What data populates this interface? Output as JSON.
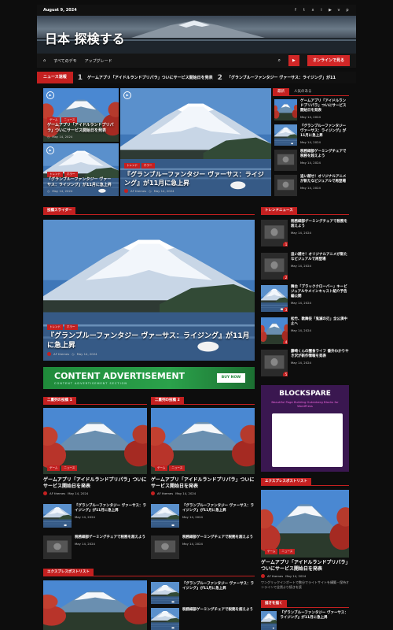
{
  "topbar": {
    "date": "August 9, 2024",
    "socials": [
      "f",
      "t",
      "x",
      "i",
      "▶",
      "v",
      "p"
    ]
  },
  "header": {
    "site_title": "日本 探検する"
  },
  "nav": {
    "items": [
      "すべてのデモ",
      "アップグレード"
    ],
    "live_label": "オンラインで見る"
  },
  "ticker": {
    "label": "ニュース速報",
    "items": [
      {
        "num": "1",
        "text": "ゲームアプリ「アイドルランドプリパラ」ついにサービス開始日を発表"
      },
      {
        "num": "2",
        "text": "「グランブルーファンタジー ヴァーサス：ライジング」が11"
      }
    ]
  },
  "hero": {
    "left_cards": [
      {
        "tags": [
          "ゲーム",
          "ニュース"
        ],
        "title": "ゲームアプリ「アイドルランドプリパラ」ついにサービス開始日を発表",
        "date": "May 14, 2024"
      },
      {
        "tags": [
          "トレンド",
          "ホラー"
        ],
        "title": "『グランブルーファンタジー ヴァーサス：ライジング』が11月に急上昇",
        "date": "May 14, 2024"
      }
    ],
    "main": {
      "tags": [
        "トレンド",
        "ホラー"
      ],
      "title": "『グランブルーファンタジー ヴァーサス：ライジング』が11月に急上昇",
      "author": "AF themes",
      "date": "May 14, 2024"
    }
  },
  "tabs": {
    "latest": "最新",
    "popular": "人気のある"
  },
  "side_posts": [
    {
      "title": "ゲームアプリ「アイドルランドプリパラ」ついにサービス開始日を発表",
      "date": "May 14, 2024"
    },
    {
      "title": "『グランブルーファンタジー ヴァーサス：ライジング』が11月に急上昇",
      "date": "May 14, 2024"
    },
    {
      "title": "税務細部ゲーミングチェアで税務を超えよう",
      "date": "May 14, 2024"
    },
    {
      "title": "追い越せ！オリジナルアニメが新たなビジュアルで再登場",
      "date": "May 14, 2024"
    }
  ],
  "slider": {
    "section": "投稿スライダー",
    "title": "『グランブルーファンタジー ヴァーサス：ライジング』が11月に急上昇",
    "tags": [
      "トレンド",
      "ホラー"
    ],
    "author": "AF themes",
    "date": "May 14, 2024"
  },
  "trending": {
    "section": "トレンドニュース",
    "items": [
      {
        "num": "1",
        "title": "税務細部ゲーミングチェアで税務を超えよう",
        "date": "May 14, 2024"
      },
      {
        "num": "2",
        "title": "追い越せ！オリジナルアニメが新たなビジュアルで再登場",
        "date": "May 14, 2024"
      },
      {
        "num": "3",
        "title": "舞台「ブラッククローバー」キービジュアルやメインキャスト紹介予告編公開",
        "date": "May 14, 2024"
      },
      {
        "num": "4",
        "title": "松竹、歌舞伎「鬼滅の刃」全公演中止へ",
        "date": "May 14, 2024"
      },
      {
        "num": "5",
        "title": "藤崎くんの闇食ライフ 番外わかりやき沢が新作情報を発表",
        "date": "May 14, 2024"
      }
    ]
  },
  "ad": {
    "big": "CONTENT ADVERTISEMENT",
    "small": "CONTENT ADVERTISEMENT SECTION",
    "button": "BUY NOW"
  },
  "blockspare": {
    "title": "BLOCKSPARE",
    "subtitle": "Beautiful Page Building Gutenberg Blocks for WordPress"
  },
  "col1": {
    "section": "二重列の投稿 1",
    "tags": [
      "ゲーム",
      "ニュース"
    ],
    "title": "ゲームアプリ「アイドルランドプリパラ」ついにサービス開始日を発表",
    "author": "AF themes",
    "date": "May 14, 2024",
    "list": [
      {
        "title": "『グランブルーファンタジー ヴァーサス：ライジング』が11月に急上昇",
        "date": "May 14, 2024"
      },
      {
        "title": "税務細部ゲーミングチェアで税務を超えよう",
        "date": "May 14, 2024"
      }
    ]
  },
  "col2": {
    "section": "二重列の投稿 2",
    "tags": [
      "ゲーム",
      "ニュース"
    ],
    "title": "ゲームアプリ「アイドルランドプリパラ」ついにサービス開始日を発表",
    "author": "AF themes",
    "date": "May 14, 2024",
    "list": [
      {
        "title": "『グランブルーファンタジー ヴァーサス：ライジング』が11月に急上昇",
        "date": "May 14, 2024"
      },
      {
        "title": "税務細部ゲーミングチェアで税務を超えよう",
        "date": "May 14, 2024"
      }
    ]
  },
  "express_right": {
    "section": "エクスプレスポストリスト",
    "tags": [
      "ゲーム",
      "ニュース"
    ],
    "title": "ゲームアプリ「アイドルランドプリパラ」ついにサービス開始日を発表",
    "author": "AF themes",
    "date": "May 14, 2024",
    "excerpt": "ワングリックインポートで数分でライトサイトを構築・保持オンラインで全然より続きを読"
  },
  "express_left": {
    "section": "エクスプレスポストリスト",
    "list": [
      {
        "title": "『グランブルーファンタジー ヴァーサス：ライジング』が11月に急上昇"
      },
      {
        "title": "税務細部ゲーミングチェアで税務を超えよう"
      }
    ]
  },
  "tab_section": {
    "label": "描きを描く",
    "item": "『グランブルーファンタジー ヴァーサス：ライジング』が11月に急上昇"
  }
}
